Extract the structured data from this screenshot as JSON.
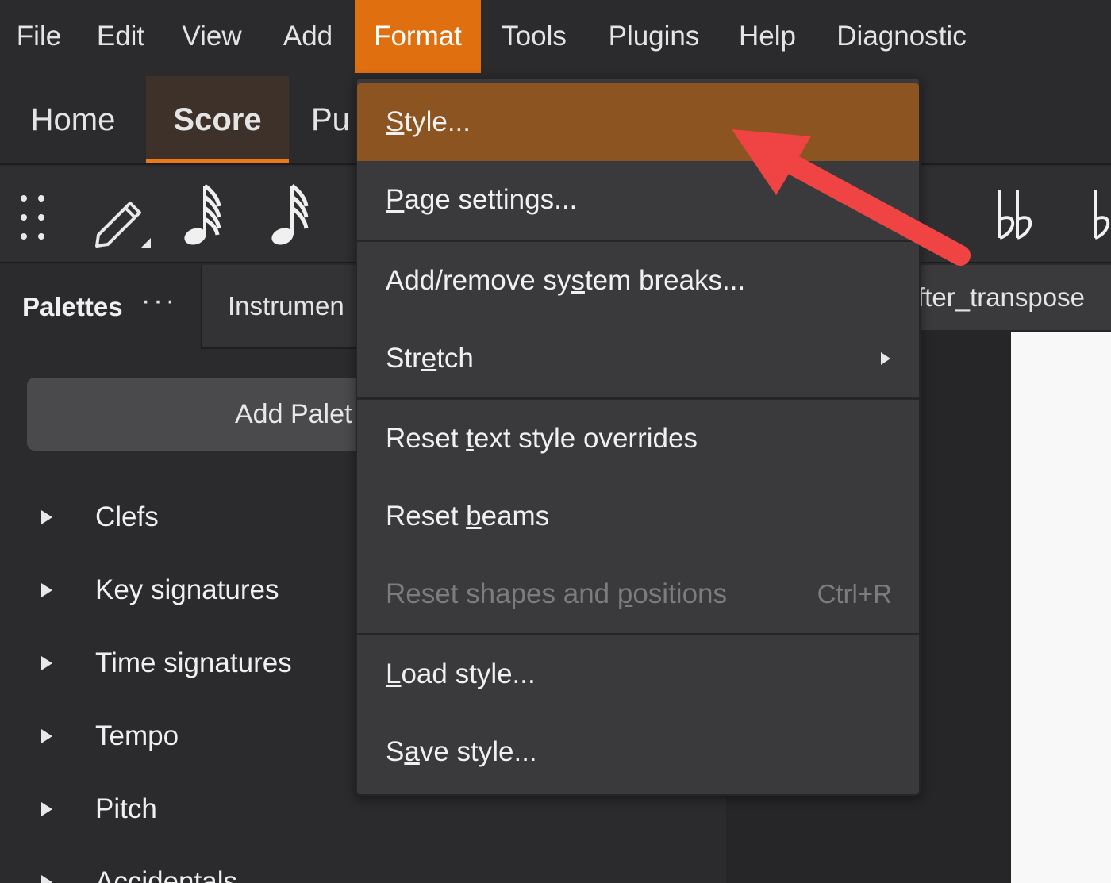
{
  "menubar": {
    "items": [
      "File",
      "Edit",
      "View",
      "Add",
      "Format",
      "Tools",
      "Plugins",
      "Help",
      "Diagnostic"
    ],
    "active": "Format",
    "accent_color": "#e06f10"
  },
  "workspace_tabs": {
    "home": "Home",
    "score": "Score",
    "publish_partial": "Pu"
  },
  "toolbar": {
    "icons": [
      "drag-handle-icon",
      "pencil-icon",
      "64th-note-icon",
      "32nd-note-icon",
      "double-flat-icon",
      "flat-icon"
    ]
  },
  "palettes_panel": {
    "tab_palettes": "Palettes",
    "tab_more": "···",
    "tab_instruments": "Instrumen",
    "add_palettes_button": "Add Palet",
    "items": [
      "Clefs",
      "Key signatures",
      "Time signatures",
      "Tempo",
      "Pitch",
      "Accidentals"
    ]
  },
  "score": {
    "tab_title": "fter_transpose"
  },
  "format_menu": {
    "items": [
      {
        "label": "Style...",
        "mnemonic_index": 0
      },
      {
        "label": "Page settings...",
        "mnemonic_index": 0
      },
      {
        "label": "Add/remove system breaks...",
        "mnemonic_index": 13
      },
      {
        "label": "Stretch",
        "mnemonic_index": 3,
        "submenu": true
      },
      {
        "label": "Reset text style overrides",
        "mnemonic_index": 6
      },
      {
        "label": "Reset beams",
        "mnemonic_index": 6
      },
      {
        "label": "Reset shapes and positions",
        "mnemonic_index": 17,
        "shortcut": "Ctrl+R",
        "disabled": true
      },
      {
        "label": "Load style...",
        "mnemonic_index": 0
      },
      {
        "label": "Save style...",
        "mnemonic_index": 1
      }
    ],
    "highlighted": "Style...",
    "highlight_color": "#8b5420"
  },
  "annotation": {
    "arrow_color": "#f04444",
    "points_to": "Style..."
  }
}
